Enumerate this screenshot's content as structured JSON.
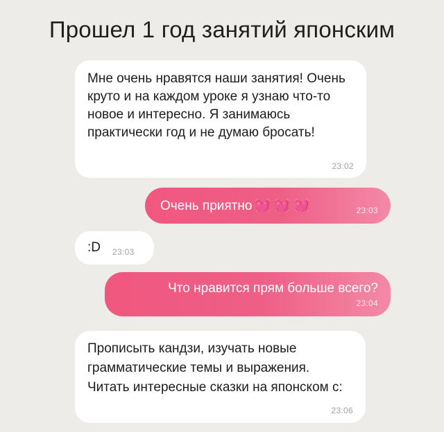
{
  "title": "Прошел 1 год занятий японским",
  "colors": {
    "background": "#eeece9",
    "incoming_bubble": "#ffffff",
    "outgoing_bubble_start": "#f0577f",
    "outgoing_bubble_end": "#f389a6"
  },
  "messages": [
    {
      "direction": "incoming",
      "text": "Мне очень нравятся наши занятия! Очень круто и на каждом уроке я узнаю что-то новое и интересно. Я занимаюсь практически год и не думаю бросать!",
      "time": "23:02"
    },
    {
      "direction": "outgoing",
      "text": "Очень приятно",
      "emoji": "💓💓💓",
      "time": "23:03"
    },
    {
      "direction": "incoming",
      "text": ":D",
      "time": "23:03"
    },
    {
      "direction": "outgoing",
      "text": "Что нравится прям больше всего?",
      "time": "23:04"
    },
    {
      "direction": "incoming",
      "text": "Прописыть кандзи, изучать новые грамматические темы и выражения. Читать интересные сказки на японском с:",
      "time": "23:06"
    }
  ]
}
